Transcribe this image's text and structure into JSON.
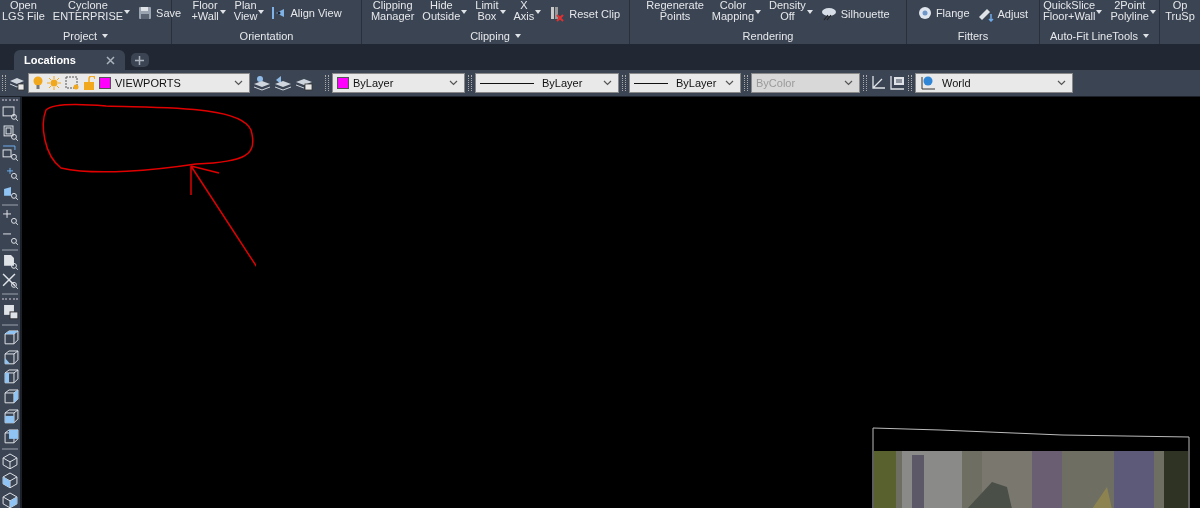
{
  "ribbon": {
    "panels": [
      {
        "title": "Project",
        "menu": true,
        "buttons": [
          {
            "kind": "large",
            "lines": [
              "Open",
              "LGS File"
            ],
            "dropdown": false
          },
          {
            "kind": "large",
            "lines": [
              "Cyclone",
              "ENTERPRISE"
            ],
            "dropdown": true
          },
          {
            "kind": "small",
            "label": "Save",
            "dropdown": false
          }
        ]
      },
      {
        "title": "Orientation",
        "menu": false,
        "buttons": [
          {
            "kind": "large",
            "lines": [
              "Floor",
              "+Wall"
            ],
            "dropdown": true
          },
          {
            "kind": "large",
            "lines": [
              "Plan",
              "View"
            ],
            "dropdown": true
          },
          {
            "kind": "small",
            "label": "Align View",
            "dropdown": false
          }
        ]
      },
      {
        "title": "Clipping",
        "menu": true,
        "buttons": [
          {
            "kind": "large",
            "lines": [
              "Clipping",
              "Manager"
            ],
            "dropdown": false
          },
          {
            "kind": "large",
            "lines": [
              "Hide",
              "Outside"
            ],
            "dropdown": true
          },
          {
            "kind": "large",
            "lines": [
              "Limit",
              "Box"
            ],
            "dropdown": true
          },
          {
            "kind": "large",
            "lines": [
              "X",
              "Axis"
            ],
            "dropdown": true
          },
          {
            "kind": "small",
            "label": "Reset Clip",
            "dropdown": false
          }
        ]
      },
      {
        "title": "Rendering",
        "menu": false,
        "buttons": [
          {
            "kind": "large",
            "lines": [
              "Regenerate",
              "Points"
            ],
            "dropdown": false
          },
          {
            "kind": "large",
            "lines": [
              "Color",
              "Mapping"
            ],
            "dropdown": true
          },
          {
            "kind": "large",
            "lines": [
              "Density",
              "Off"
            ],
            "dropdown": true
          },
          {
            "kind": "small",
            "label": "Silhouette",
            "dropdown": false
          }
        ]
      },
      {
        "title": "Fitters",
        "menu": false,
        "buttons": [
          {
            "kind": "small",
            "label": "Flange",
            "dropdown": false
          },
          {
            "kind": "small",
            "label": "Adjust",
            "dropdown": false
          }
        ]
      },
      {
        "title": "Auto-Fit LineTools",
        "menu": true,
        "buttons": [
          {
            "kind": "large",
            "lines": [
              "QuickSlice",
              "Floor+Wall"
            ],
            "dropdown": true
          },
          {
            "kind": "large",
            "lines": [
              "2Point",
              "Polyline"
            ],
            "dropdown": true
          }
        ]
      },
      {
        "buttons": [
          {
            "kind": "large",
            "lines": [
              "Op",
              "TruSp"
            ],
            "dropdown": false
          }
        ]
      }
    ]
  },
  "tabs": [
    {
      "label": "Locations",
      "selected": true
    }
  ],
  "properties": {
    "layer": "VIEWPORTS",
    "color_setting": "ByLayer",
    "linetype": "ByLayer",
    "lineweight": "ByLayer",
    "plot_style": {
      "value": "ByColor",
      "disabled": true
    },
    "ucs": "World"
  }
}
